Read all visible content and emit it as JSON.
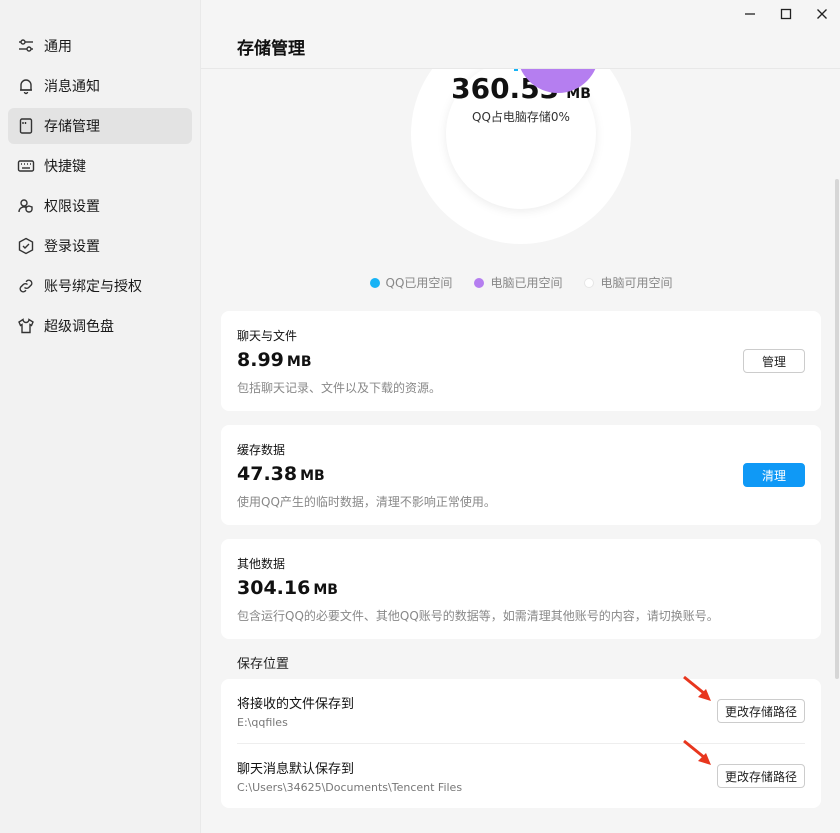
{
  "sidebar": {
    "items": [
      {
        "label": "通用",
        "icon": "sliders-icon"
      },
      {
        "label": "消息通知",
        "icon": "bell-icon"
      },
      {
        "label": "存储管理",
        "icon": "storage-icon"
      },
      {
        "label": "快捷键",
        "icon": "keyboard-icon"
      },
      {
        "label": "权限设置",
        "icon": "user-shield-icon"
      },
      {
        "label": "登录设置",
        "icon": "hexagon-shield-icon"
      },
      {
        "label": "账号绑定与授权",
        "icon": "link-icon"
      },
      {
        "label": "超级调色盘",
        "icon": "tshirt-icon"
      }
    ],
    "active_index": 2
  },
  "header": {
    "title": "存储管理"
  },
  "summary": {
    "value": "360.53",
    "unit": "MB",
    "subtitle": "QQ占电脑存储0%"
  },
  "legend": [
    {
      "label": "QQ已用空间",
      "color": "#17b3f5"
    },
    {
      "label": "电脑已用空间",
      "color": "#b57ef0"
    },
    {
      "label": "电脑可用空间",
      "color": "#f2f2f2"
    }
  ],
  "cards": {
    "chat": {
      "title": "聊天与文件",
      "value": "8.99",
      "unit": "MB",
      "desc": "包括聊天记录、文件以及下载的资源。",
      "button": "管理"
    },
    "cache": {
      "title": "缓存数据",
      "value": "47.38",
      "unit": "MB",
      "desc": "使用QQ产生的临时数据，清理不影响正常使用。",
      "button": "清理"
    },
    "other": {
      "title": "其他数据",
      "value": "304.16",
      "unit": "MB",
      "desc": "包含运行QQ的必要文件、其他QQ账号的数据等，如需清理其他账号的内容，请切换账号。"
    }
  },
  "storage_location": {
    "section_label": "保存位置",
    "rows": [
      {
        "label": "将接收的文件保存到",
        "path": "E:\\qqfiles",
        "button": "更改存储路径"
      },
      {
        "label": "聊天消息默认保存到",
        "path": "C:\\Users\\34625\\Documents\\Tencent Files",
        "button": "更改存储路径"
      }
    ]
  },
  "colors": {
    "accent": "#0f99f6",
    "qq_used": "#17b3f5",
    "pc_used": "#b57ef0",
    "annotation_arrow": "#e8361e"
  }
}
